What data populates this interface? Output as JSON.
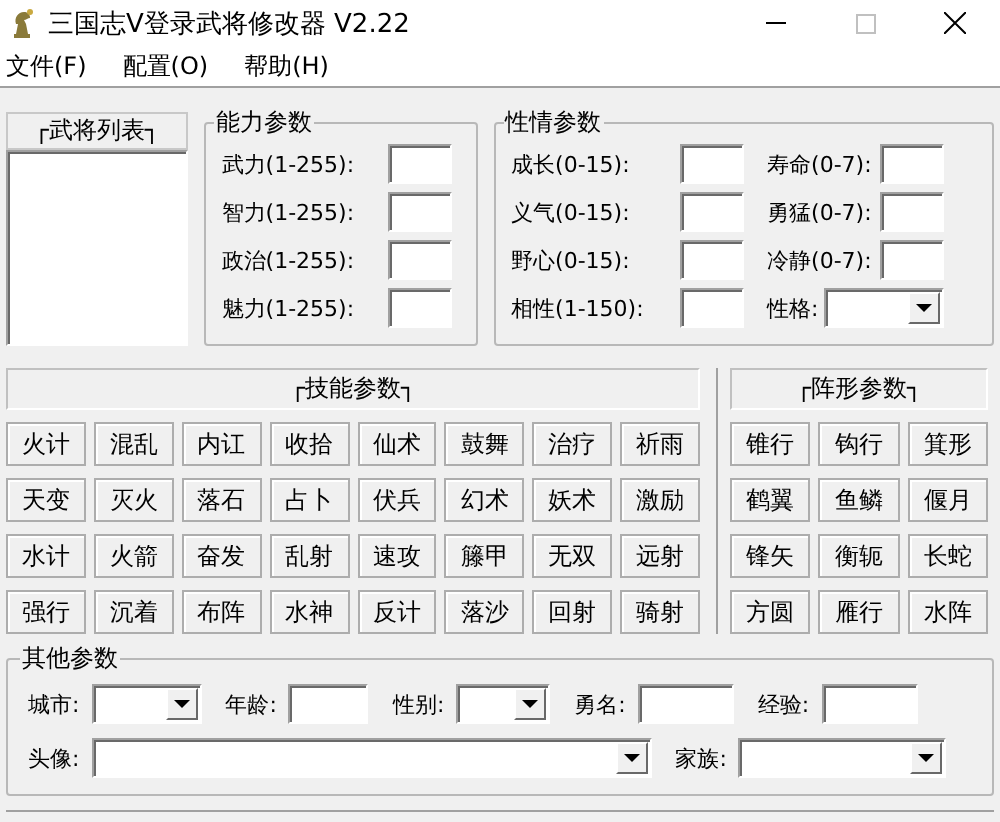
{
  "window": {
    "title": "三国志Ⅴ登录武将修改器 V2.22"
  },
  "menu": [
    "文件(F)",
    "配置(O)",
    "帮助(H)"
  ],
  "general_list": {
    "header": "┌武将列表┐"
  },
  "ability": {
    "title": "能力参数",
    "fields": [
      {
        "label": "武力(1-255):",
        "kind": "text"
      },
      {
        "label": "智力(1-255):",
        "kind": "text"
      },
      {
        "label": "政治(1-255):",
        "kind": "text"
      },
      {
        "label": "魅力(1-255):",
        "kind": "text"
      }
    ]
  },
  "temperament": {
    "title": "性情参数",
    "left": [
      {
        "label": "成长(0-15):",
        "kind": "text"
      },
      {
        "label": "义气(0-15):",
        "kind": "text"
      },
      {
        "label": "野心(0-15):",
        "kind": "text"
      },
      {
        "label": "相性(1-150):",
        "kind": "text"
      }
    ],
    "right": [
      {
        "label": "寿命(0-7):",
        "kind": "text"
      },
      {
        "label": "勇猛(0-7):",
        "kind": "text"
      },
      {
        "label": "冷静(0-7):",
        "kind": "text"
      },
      {
        "label": "性格:",
        "kind": "combo"
      }
    ]
  },
  "skills": {
    "header": "┌技能参数┐",
    "buttons": [
      "火计",
      "混乱",
      "内讧",
      "收拾",
      "仙术",
      "鼓舞",
      "治疗",
      "祈雨",
      "天变",
      "灭火",
      "落石",
      "占卜",
      "伏兵",
      "幻术",
      "妖术",
      "激励",
      "水计",
      "火箭",
      "奋发",
      "乱射",
      "速攻",
      "籐甲",
      "无双",
      "远射",
      "强行",
      "沉着",
      "布阵",
      "水神",
      "反计",
      "落沙",
      "回射",
      "骑射"
    ]
  },
  "formations": {
    "header": "┌阵形参数┐",
    "buttons": [
      "锥行",
      "钩行",
      "箕形",
      "鹤翼",
      "鱼鳞",
      "偃月",
      "锋矢",
      "衡轭",
      "长蛇",
      "方圆",
      "雁行",
      "水阵"
    ]
  },
  "other": {
    "title": "其他参数",
    "rows": [
      [
        {
          "label": "城市:",
          "kind": "combo"
        },
        {
          "label": "年龄:",
          "kind": "text"
        },
        {
          "label": "性别:",
          "kind": "combo"
        },
        {
          "label": "勇名:",
          "kind": "text"
        },
        {
          "label": "经验:",
          "kind": "text"
        }
      ],
      [
        {
          "label": "头像:",
          "kind": "combo"
        },
        {
          "label": "家族:",
          "kind": "combo"
        }
      ]
    ]
  }
}
